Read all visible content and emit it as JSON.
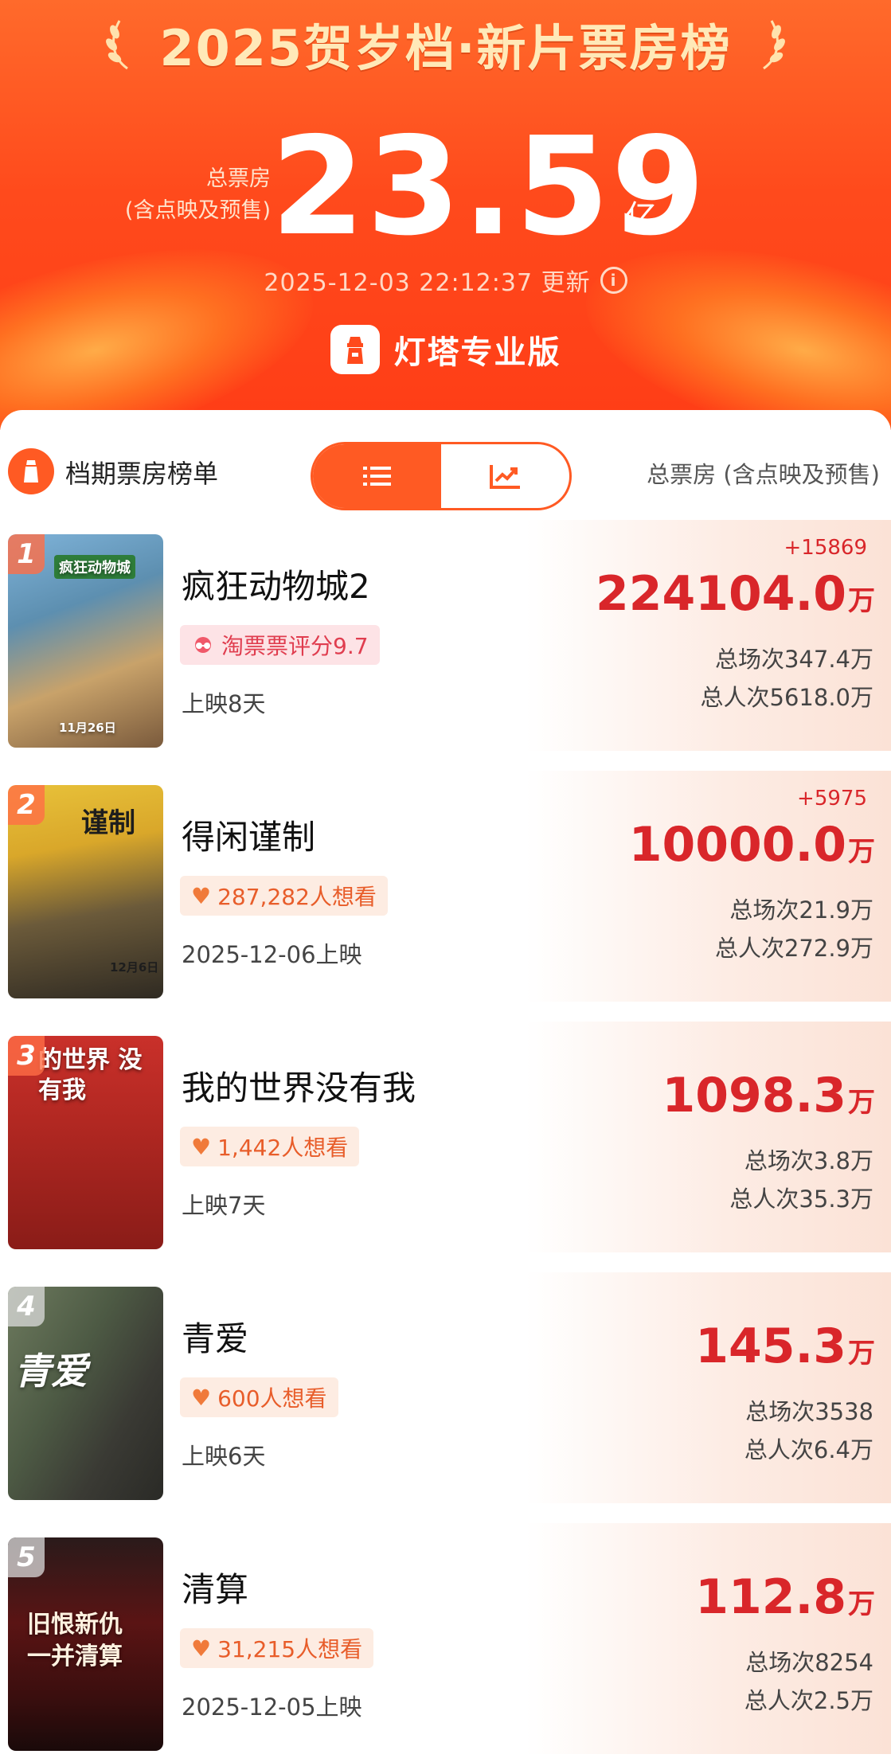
{
  "header": {
    "title": "2025贺岁档·新片票房榜",
    "total_label_line1": "总票房",
    "total_label_line2": "(含点映及预售)",
    "total_value": "23.59",
    "total_unit": "亿",
    "update_time": "2025-12-03 22:12:37 更新",
    "brand": "灯塔专业版"
  },
  "list_header": {
    "title": "档期票房榜单",
    "column_label": "总票房 (含点映及预售)",
    "views": [
      "list-icon",
      "chart-icon"
    ],
    "active_view": "list-icon"
  },
  "movies": [
    {
      "rank": "1",
      "title": "疯狂动物城2",
      "tag": "淘票票评分9.7",
      "tag_type": "rating",
      "sub": "上映8天",
      "delta": "+15869",
      "box_value": "224104.0",
      "box_unit": "万",
      "screenings": "总场次347.4万",
      "admissions": "总人次5618.0万",
      "poster_text": "疯狂动物城",
      "poster_date": "11月26日"
    },
    {
      "rank": "2",
      "title": "得闲谨制",
      "tag": "287,282人想看",
      "tag_type": "want",
      "sub": "2025-12-06上映",
      "delta": "+5975",
      "box_value": "10000.0",
      "box_unit": "万",
      "screenings": "总场次21.9万",
      "admissions": "总人次272.9万",
      "poster_text": "谨制",
      "poster_date": "12月6日"
    },
    {
      "rank": "3",
      "title": "我的世界没有我",
      "tag": "1,442人想看",
      "tag_type": "want",
      "sub": "上映7天",
      "delta": "",
      "box_value": "1098.3",
      "box_unit": "万",
      "screenings": "总场次3.8万",
      "admissions": "总人次35.3万",
      "poster_text": "的世界 没有我",
      "poster_date": ""
    },
    {
      "rank": "4",
      "title": "青爱",
      "tag": "600人想看",
      "tag_type": "want",
      "sub": "上映6天",
      "delta": "",
      "box_value": "145.3",
      "box_unit": "万",
      "screenings": "总场次3538",
      "admissions": "总人次6.4万",
      "poster_text": "青爱",
      "poster_date": ""
    },
    {
      "rank": "5",
      "title": "清算",
      "tag": "31,215人想看",
      "tag_type": "want",
      "sub": "2025-12-05上映",
      "delta": "",
      "box_value": "112.8",
      "box_unit": "万",
      "screenings": "总场次8254",
      "admissions": "总人次2.5万",
      "poster_text": "旧恨新仇 一并清算",
      "poster_date": ""
    }
  ],
  "colors": {
    "accent": "#ff5a23",
    "box_red": "#d9262a",
    "header_bg": "#ff4a1c"
  }
}
